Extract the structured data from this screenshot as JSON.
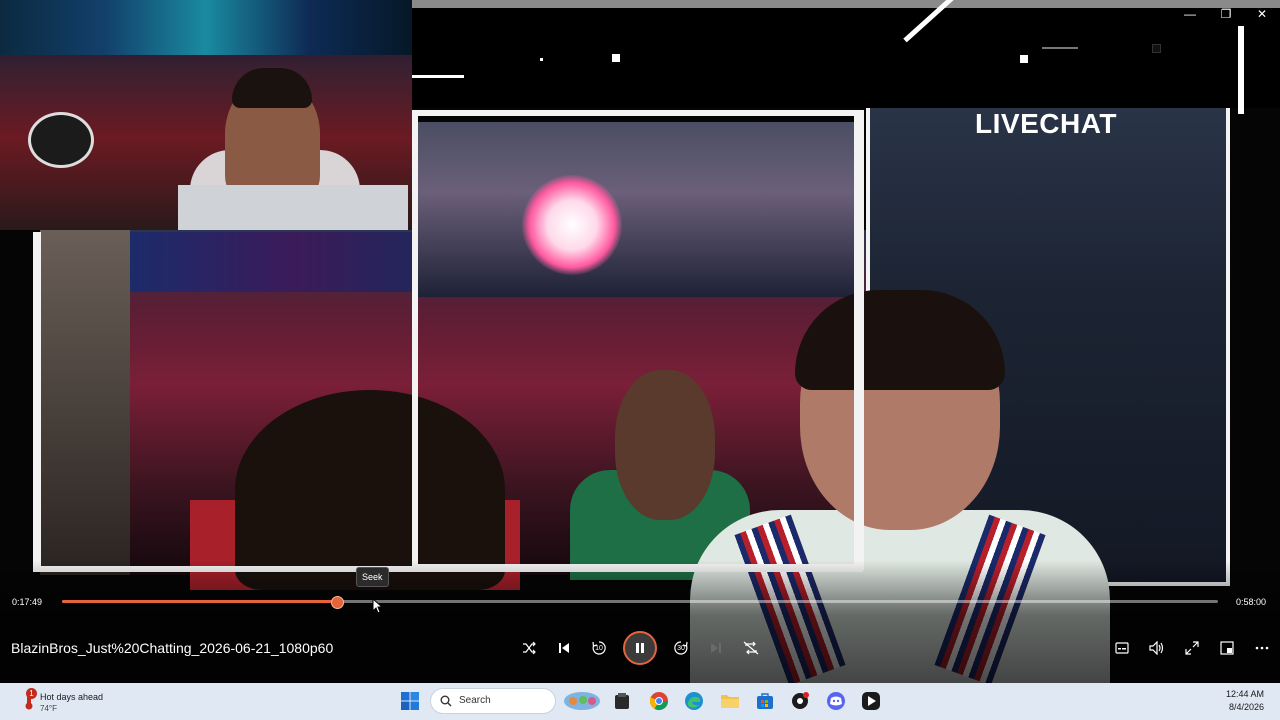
{
  "video": {
    "overlay_text": "LIVECHAT",
    "file_title": "BlazinBros_Just%20Chatting_2026-06-21_1080p60"
  },
  "player": {
    "current_time": "0:17:49",
    "total_time": "0:58:00",
    "progress_fraction": 0.2368,
    "seek_tooltip": "Seek",
    "skip_back_seconds": "10",
    "skip_forward_seconds": "30",
    "accent_color": "#e5643a",
    "icons": [
      "shuffle-icon",
      "previous-icon",
      "skip-back-icon",
      "pause-icon",
      "skip-forward-icon",
      "next-icon",
      "repeat-icon",
      "subtitles-icon",
      "volume-icon",
      "fullscreen-icon",
      "miniplayer-icon",
      "more-icon"
    ]
  },
  "window": {
    "minimize": "—",
    "restore": "❐",
    "close": "✕"
  },
  "taskbar": {
    "weather_title": "Hot days ahead",
    "weather_temp": "74°F",
    "weather_badge": "1",
    "search_placeholder": "Search",
    "time": "12:44 AM",
    "date": "8/4/2026",
    "apps": [
      "windows-start",
      "search",
      "game-app",
      "file-app",
      "chrome",
      "edge",
      "file-explorer",
      "store",
      "app-red",
      "discord",
      "media-player"
    ]
  }
}
